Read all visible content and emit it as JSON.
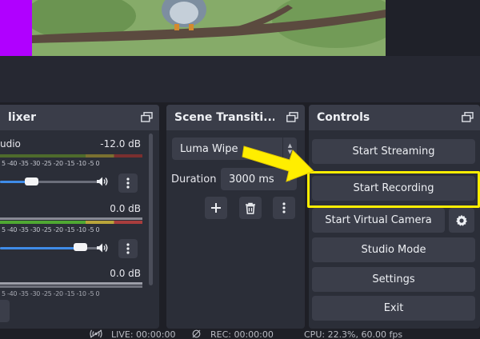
{
  "mixer": {
    "title": "lixer",
    "channels": [
      {
        "name": "udio",
        "db": "-12.0 dB",
        "volume": 0.21
      },
      {
        "name": "",
        "db": "0.0 dB",
        "volume": 0.53
      },
      {
        "name": "",
        "db": "0.0 dB",
        "volume": null
      }
    ],
    "tick_labels": "5 -40 -35 -30 -25 -20 -15 -10 -5 0"
  },
  "transitions": {
    "title": "Scene Transiti...",
    "selected": "Luma Wipe",
    "duration_label": "Duration",
    "duration_value": "3000 ms"
  },
  "controls": {
    "title": "Controls",
    "buttons": {
      "start_streaming": "Start Streaming",
      "start_recording": "Start Recording",
      "start_virtual_camera": "Start Virtual Camera",
      "studio_mode": "Studio Mode",
      "settings": "Settings",
      "exit": "Exit"
    }
  },
  "status": {
    "live": "LIVE: 00:00:00",
    "rec": "REC: 00:00:00",
    "cpu": "CPU: 22.3%, 60.00 fps"
  },
  "colors": {
    "accent": "#3f8ce8",
    "highlight": "#ffee00",
    "arrow": "#ffee00"
  }
}
